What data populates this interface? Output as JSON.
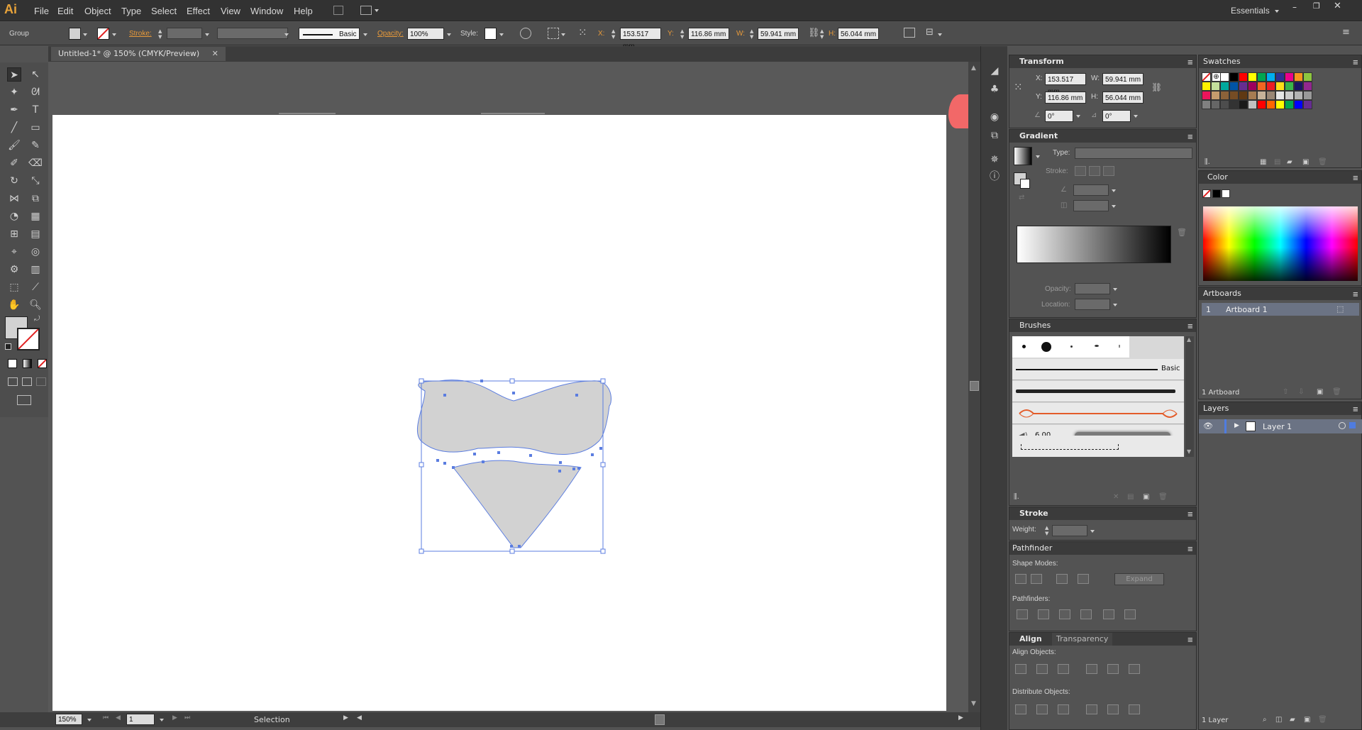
{
  "app": {
    "logo": "Ai",
    "workspace": "Essentials"
  },
  "menu": [
    "File",
    "Edit",
    "Object",
    "Type",
    "Select",
    "Effect",
    "View",
    "Window",
    "Help"
  ],
  "control": {
    "selection_type": "Group",
    "stroke_label": "Stroke:",
    "brush_label": "Basic",
    "opacity_label": "Opacity:",
    "opacity_value": "100%",
    "style_label": "Style:",
    "x_label": "X:",
    "x_value": "153.517 mm",
    "y_label": "Y:",
    "y_value": "116.86 mm",
    "w_label": "W:",
    "w_value": "59.941 mm",
    "h_label": "H:",
    "h_value": "56.044 mm"
  },
  "document": {
    "tab": "Untitled-1* @ 150% (CMYK/Preview)"
  },
  "status": {
    "zoom": "150%",
    "page": "1",
    "tool": "Selection"
  },
  "transform": {
    "title": "Transform",
    "x_label": "X:",
    "x": "153.517 mm",
    "y_label": "Y:",
    "y": "116.86 mm",
    "w_label": "W:",
    "w": "59.941 mm",
    "h_label": "H:",
    "h": "56.044 mm",
    "rotate": "0°",
    "shear": "0°"
  },
  "gradient": {
    "title": "Gradient",
    "type_label": "Type:",
    "stroke_label": "Stroke:",
    "opacity_label": "Opacity:",
    "location_label": "Location:"
  },
  "brushes": {
    "title": "Brushes",
    "basic_label": "Basic",
    "size_value": "6.00"
  },
  "stroke": {
    "title": "Stroke",
    "weight_label": "Weight:"
  },
  "pathfinder": {
    "title": "Pathfinder",
    "shape_modes_label": "Shape Modes:",
    "expand_label": "Expand",
    "pathfinders_label": "Pathfinders:"
  },
  "align": {
    "title": "Align",
    "tab2": "Transparency",
    "align_objects_label": "Align Objects:",
    "distribute_objects_label": "Distribute Objects:"
  },
  "swatches": {
    "title": "Swatches",
    "colors": [
      "#ffffff",
      "#000000",
      "#ff0000",
      "#ffff00",
      "#00a651",
      "#00aeef",
      "#2e3192",
      "#ec008c",
      "#f7941d",
      "#8dc63f",
      "#fff200",
      "#c4df9b",
      "#00a99d",
      "#0054a6",
      "#662d91",
      "#9e005d",
      "#f26522",
      "#ed1c24",
      "#ffde17",
      "#39b54a",
      "#1b1464",
      "#92278f",
      "#ed145b",
      "#c69c6d",
      "#8c6239",
      "#754c24",
      "#603913",
      "#a67c52",
      "#c7b299",
      "#998675",
      "#e6e6e6",
      "#cccccc",
      "#b3b3b3",
      "#999999",
      "#808080",
      "#666666",
      "#4d4d4d",
      "#333333",
      "#1a1a1a",
      "#c0c0c0",
      "#ff0000",
      "#ff6600",
      "#ffff00",
      "#00a651",
      "#0000ff",
      "#662d91"
    ]
  },
  "color": {
    "title": "Color"
  },
  "artboards": {
    "title": "Artboards",
    "row_num": "1",
    "row_name": "Artboard 1",
    "count": "1 Artboard"
  },
  "layers": {
    "title": "Layers",
    "layer_name": "Layer 1",
    "count": "1 Layer"
  }
}
